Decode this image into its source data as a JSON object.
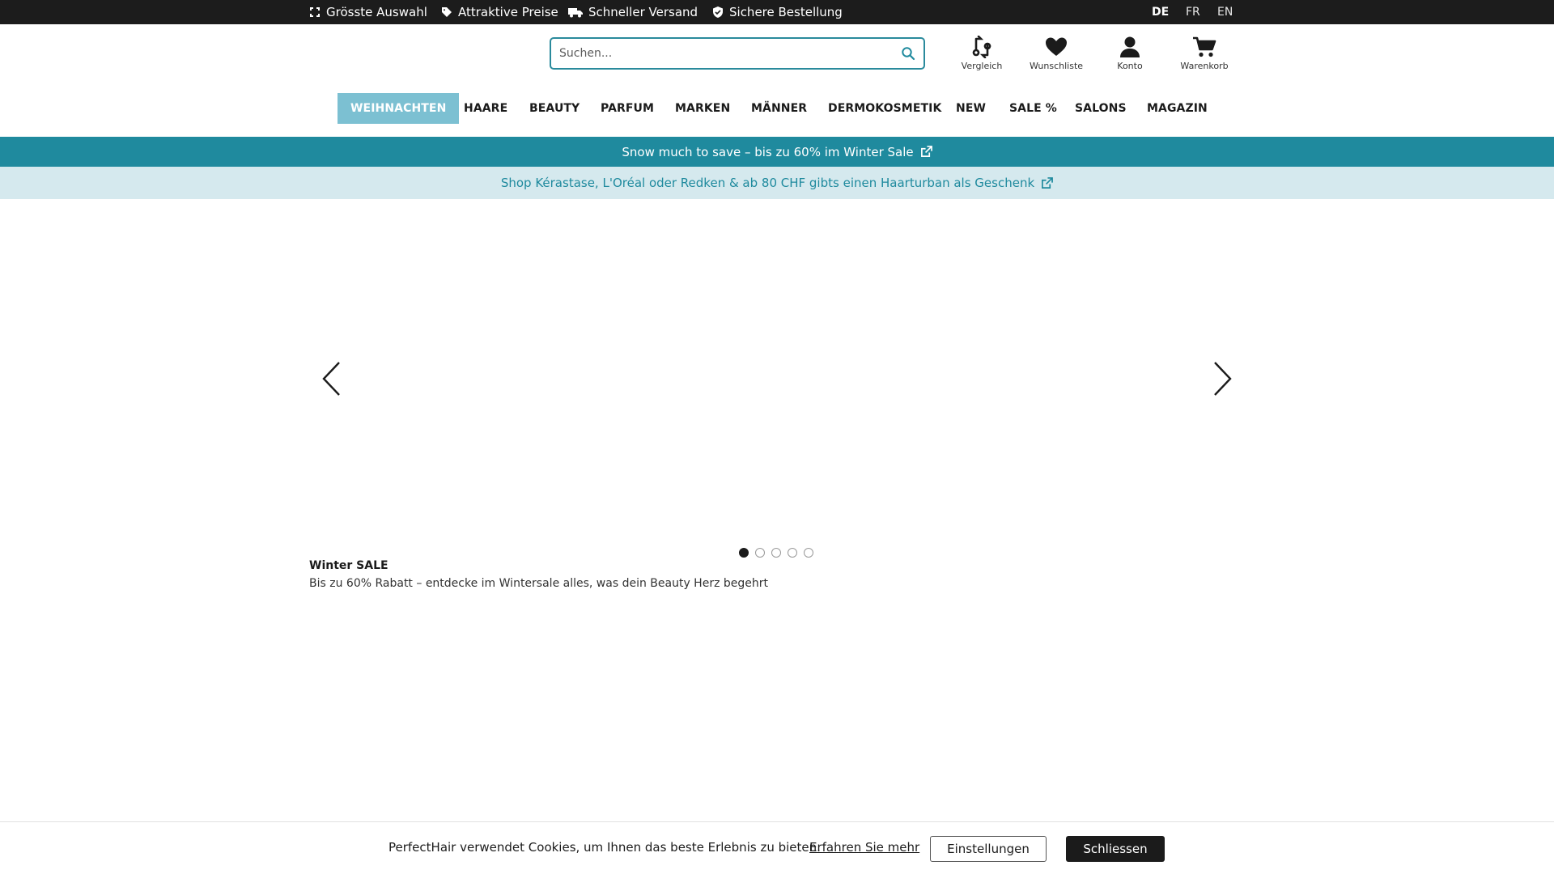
{
  "topbar": {
    "usps": [
      {
        "label": "Grösste Auswahl",
        "icon": "expand-icon"
      },
      {
        "label": "Attraktive Preise",
        "icon": "tag-icon"
      },
      {
        "label": "Schneller Versand",
        "icon": "truck-icon"
      },
      {
        "label": "Sichere Bestellung",
        "icon": "shield-check-icon"
      }
    ],
    "languages": [
      "DE",
      "FR",
      "EN"
    ],
    "active_language": "DE"
  },
  "header": {
    "search": {
      "placeholder": "Suchen..."
    },
    "icons": [
      {
        "label": "Vergleich",
        "icon": "compare-icon"
      },
      {
        "label": "Wunschliste",
        "icon": "heart-icon"
      },
      {
        "label": "Konto",
        "icon": "user-icon"
      },
      {
        "label": "Warenkorb",
        "icon": "cart-icon"
      }
    ]
  },
  "nav": {
    "items": [
      "WEIHNACHTEN",
      "HAARE",
      "BEAUTY",
      "PARFUM",
      "MARKEN",
      "MÄNNER",
      "DERMOKOSMETIK",
      "NEW",
      "SALE %",
      "SALONS",
      "MAGAZIN"
    ],
    "active": "WEIHNACHTEN"
  },
  "banners": {
    "primary": "Snow much to save – bis zu 60% im Winter Sale",
    "secondary": "Shop Kérastase, L'Oréal oder Redken & ab 80 CHF gibts einen Haarturban als Geschenk"
  },
  "slider": {
    "slide_count": 5,
    "active_slide": 1,
    "title": "Winter SALE",
    "text": "Bis zu 60% Rabatt – entdecke im Wintersale alles, was dein Beauty Herz begehrt"
  },
  "cookie": {
    "message": "PerfectHair verwendet Cookies, um Ihnen das beste Erlebnis zu bieten.",
    "learn_more": "Erfahren Sie mehr",
    "settings": "Einstellungen",
    "close": "Schliessen"
  },
  "colors": {
    "topbar_bg": "#1c1c1c",
    "accent": "#1f8a9e",
    "nav_active_bg": "#7cc0d2",
    "secondary_banner_bg": "#d5e9ee"
  }
}
